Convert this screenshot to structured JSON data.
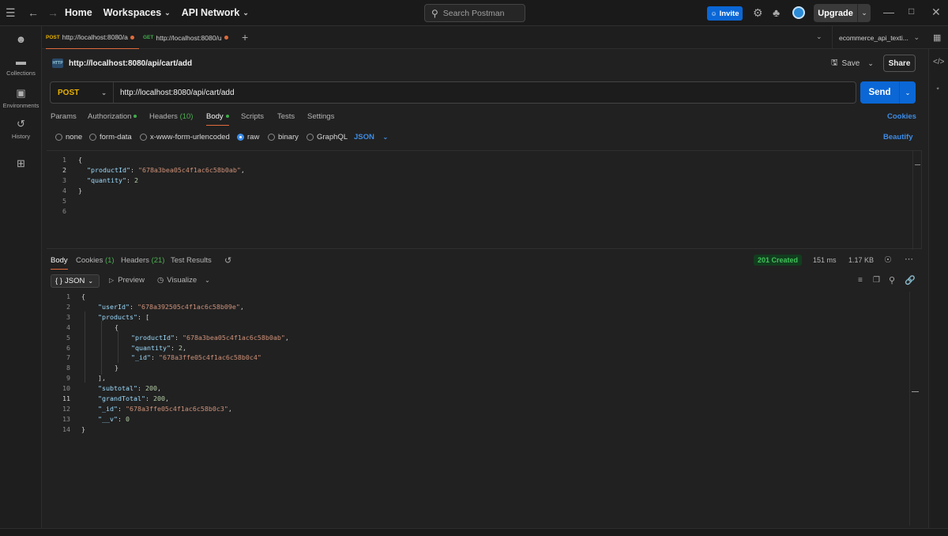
{
  "topbar": {
    "home": "Home",
    "workspaces": "Workspaces",
    "api_network": "API Network",
    "search_placeholder": "Search Postman",
    "invite": "Invite",
    "upgrade": "Upgrade"
  },
  "sidebar": {
    "items": [
      {
        "label": ""
      },
      {
        "label": "Collections"
      },
      {
        "label": "Environments"
      },
      {
        "label": "History"
      },
      {
        "label": ""
      }
    ]
  },
  "tabs": [
    {
      "method": "POST",
      "label": "http://localhost:8080/a",
      "method_color": "#e8b100"
    },
    {
      "method": "GET",
      "label": "http://localhost:8080/u",
      "method_color": "#3fae4a"
    }
  ],
  "environment": "ecommerce_api_texti...",
  "request": {
    "title": "http://localhost:8080/api/cart/add",
    "save": "Save",
    "share": "Share",
    "method": "POST",
    "url": "http://localhost:8080/api/cart/add",
    "send": "Send",
    "tabs": {
      "params": "Params",
      "authorization": "Authorization",
      "headers": "Headers",
      "headers_count": "(10)",
      "body": "Body",
      "scripts": "Scripts",
      "tests": "Tests",
      "settings": "Settings"
    },
    "cookies": "Cookies",
    "body_types": [
      "none",
      "form-data",
      "x-www-form-urlencoded",
      "raw",
      "binary",
      "GraphQL"
    ],
    "selected_body_type": "raw",
    "language": "JSON",
    "beautify": "Beautify",
    "line_numbers": [
      "1",
      "2",
      "3",
      "4",
      "5",
      "6"
    ],
    "body_lines": [
      {
        "t": "{"
      },
      {
        "k": "\"productId\"",
        "s": "\"678a3bea05c4f1ac6c58b0ab\"",
        "end": ","
      },
      {
        "k": "\"quantity\"",
        "n": "2",
        "end": ""
      },
      {
        "t": "}"
      },
      {
        "t": ""
      },
      {
        "t": ""
      }
    ]
  },
  "response": {
    "tabs": {
      "body": "Body",
      "cookies": "Cookies",
      "cookies_count": "(1)",
      "headers": "Headers",
      "headers_count": "(21)",
      "test_results": "Test Results"
    },
    "status": "201 Created",
    "time": "151 ms",
    "size": "1.17 KB",
    "format": "JSON",
    "preview": "Preview",
    "visualize": "Visualize",
    "line_numbers": [
      "1",
      "2",
      "3",
      "4",
      "5",
      "6",
      "7",
      "8",
      "9",
      "10",
      "11",
      "12",
      "13",
      "14"
    ],
    "body_lines": [
      {
        "indent": 0,
        "t": "{"
      },
      {
        "indent": 1,
        "k": "\"userId\"",
        "s": "\"678a392505c4f1ac6c58b09e\"",
        "end": ","
      },
      {
        "indent": 1,
        "k": "\"products\"",
        "t2": "[",
        "end": ""
      },
      {
        "indent": 2,
        "t": "{"
      },
      {
        "indent": 3,
        "k": "\"productId\"",
        "s": "\"678a3bea05c4f1ac6c58b0ab\"",
        "end": ","
      },
      {
        "indent": 3,
        "k": "\"quantity\"",
        "n": "2",
        "end": ","
      },
      {
        "indent": 3,
        "k": "\"_id\"",
        "s": "\"678a3ffe05c4f1ac6c58b0c4\"",
        "end": ""
      },
      {
        "indent": 2,
        "t": "}"
      },
      {
        "indent": 1,
        "t": "],"
      },
      {
        "indent": 1,
        "k": "\"subtotal\"",
        "n": "200",
        "end": ","
      },
      {
        "indent": 1,
        "k": "\"grandTotal\"",
        "n": "200",
        "end": ","
      },
      {
        "indent": 1,
        "k": "\"_id\"",
        "s": "\"678a3ffe05c4f1ac6c58b0c3\"",
        "end": ","
      },
      {
        "indent": 1,
        "k": "\"__v\"",
        "n": "0",
        "end": ""
      },
      {
        "indent": 0,
        "t": "}"
      }
    ]
  }
}
